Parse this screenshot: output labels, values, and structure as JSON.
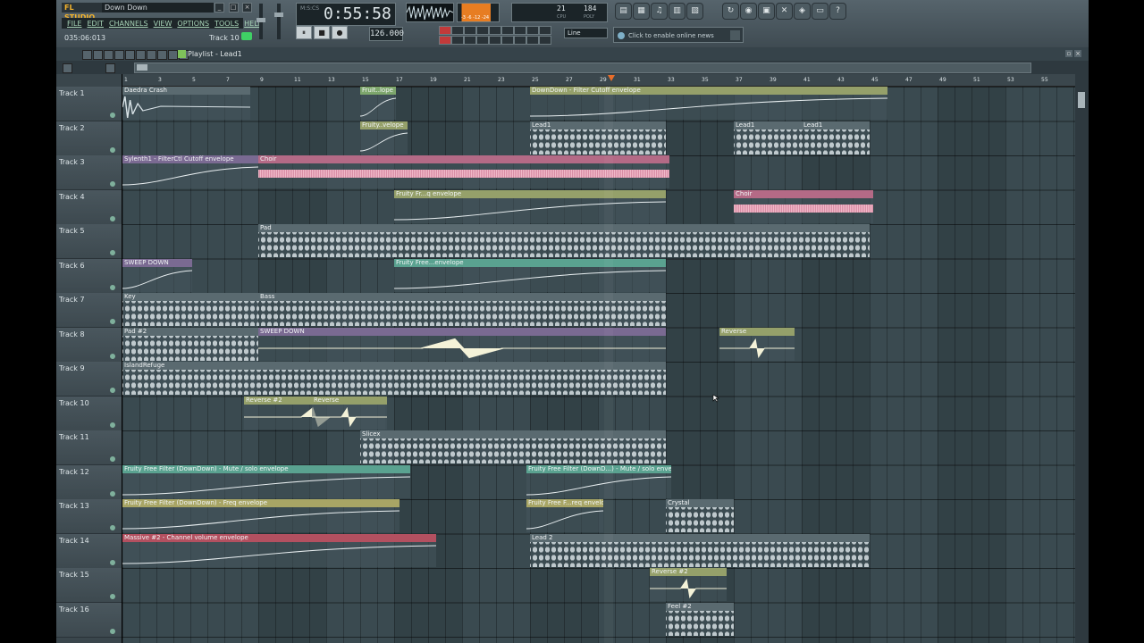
{
  "app": {
    "logo": "FL STUDIO",
    "song_name": "Down Down",
    "menu": [
      "FILE",
      "EDIT",
      "CHANNELS",
      "VIEW",
      "OPTIONS",
      "TOOLS",
      "HELP"
    ],
    "position": "035:06:013",
    "hint_track": "Track 10",
    "time_label": "M:S:CS",
    "time": "0:55:58",
    "tempo": "126.000",
    "cpu": {
      "poly_value": "21",
      "poly_label": "CPU",
      "mem_value": "184",
      "mem_label": "POLY"
    },
    "snap": "Line",
    "news": "Click to enable online news",
    "transport": {
      "pause": "⏸",
      "stop": "■",
      "record": "●"
    },
    "window_buttons": [
      "_",
      "□",
      "×"
    ]
  },
  "playlist": {
    "title": "Playlist - Lead1",
    "ruler_ticks": [
      "1",
      "3",
      "5",
      "7",
      "9",
      "11",
      "13",
      "15",
      "17",
      "19",
      "21",
      "23",
      "25",
      "27",
      "29",
      "31",
      "33",
      "35",
      "37",
      "39",
      "41",
      "43",
      "45",
      "47",
      "49",
      "51",
      "53",
      "55"
    ],
    "tracks": [
      "Track 1",
      "Track 2",
      "Track 3",
      "Track 4",
      "Track 5",
      "Track 6",
      "Track 7",
      "Track 8",
      "Track 9",
      "Track 10",
      "Track 11",
      "Track 12",
      "Track 13",
      "Track 14",
      "Track 15",
      "Track 16"
    ]
  },
  "clips": [
    {
      "row": 0,
      "label": "Daedra Crash",
      "color": "grey",
      "kind": "crash"
    },
    {
      "row": 0,
      "label": "Fruit..lope",
      "color": "green",
      "kind": "env"
    },
    {
      "row": 0,
      "label": "DownDown - Filter Cutoff envelope",
      "color": "olive",
      "kind": "env"
    },
    {
      "row": 1,
      "label": "Fruity..velope",
      "color": "olive",
      "kind": "env"
    },
    {
      "row": 1,
      "label": "Lead1",
      "color": "grey",
      "kind": "notes"
    },
    {
      "row": 1,
      "label": "Lead1",
      "color": "grey",
      "kind": "notes"
    },
    {
      "row": 1,
      "label": "Lead1",
      "color": "grey",
      "kind": "notes"
    },
    {
      "row": 2,
      "label": "Sylenth1 - FilterCtl Cutoff envelope",
      "color": "purple",
      "kind": "env"
    },
    {
      "row": 2,
      "label": "Choir",
      "color": "pink",
      "kind": "wave"
    },
    {
      "row": 3,
      "label": "Fruity Fr...q envelope",
      "color": "olive",
      "kind": "env"
    },
    {
      "row": 3,
      "label": "Choir",
      "color": "pink",
      "kind": "wave"
    },
    {
      "row": 4,
      "label": "Pad",
      "color": "grey",
      "kind": "notes"
    },
    {
      "row": 5,
      "label": "SWEEP DOWN",
      "color": "purple",
      "kind": "env"
    },
    {
      "row": 5,
      "label": "Fruity Free...envelope",
      "color": "teal",
      "kind": "env"
    },
    {
      "row": 6,
      "label": "Key",
      "color": "grey",
      "kind": "notes"
    },
    {
      "row": 6,
      "label": "Bass",
      "color": "grey",
      "kind": "notes"
    },
    {
      "row": 7,
      "label": "Pad #2",
      "color": "grey",
      "kind": "notes"
    },
    {
      "row": 7,
      "label": "SWEEP DOWN",
      "color": "purple",
      "kind": "wave"
    },
    {
      "row": 7,
      "label": "Reverse",
      "color": "olive",
      "kind": "wave"
    },
    {
      "row": 8,
      "label": "IslandRefuge",
      "color": "grey",
      "kind": "notes"
    },
    {
      "row": 9,
      "label": "Reverse #2",
      "color": "olive",
      "kind": "wave"
    },
    {
      "row": 9,
      "label": "Reverse",
      "color": "olive",
      "kind": "wave"
    },
    {
      "row": 10,
      "label": "Slicex",
      "color": "grey",
      "kind": "notes"
    },
    {
      "row": 11,
      "label": "Fruity Free Filter (DownDown) - Mute / solo envelope",
      "color": "teal",
      "kind": "env"
    },
    {
      "row": 11,
      "label": "Fruity Free Filter (DownD...) - Mute / solo envelope",
      "color": "teal",
      "kind": "env"
    },
    {
      "row": 12,
      "label": "Fruity Free Filter (DownDown) - Freq envelope",
      "color": "yel",
      "kind": "env"
    },
    {
      "row": 12,
      "label": "Fruity Free F...req envelope",
      "color": "yel",
      "kind": "env"
    },
    {
      "row": 12,
      "label": "Crystal",
      "color": "grey",
      "kind": "notes"
    },
    {
      "row": 13,
      "label": "Massive #2 - Channel volume envelope",
      "color": "red",
      "kind": "env"
    },
    {
      "row": 13,
      "label": "Lead 2",
      "color": "grey",
      "kind": "notes"
    },
    {
      "row": 14,
      "label": "Reverse #2",
      "color": "olive",
      "kind": "wave"
    },
    {
      "row": 15,
      "label": "Feel #2",
      "color": "grey",
      "kind": "notes"
    }
  ],
  "colors": {
    "accent": "#f7b52b",
    "playhead": "#e86d2a",
    "pink_wave": "#f0b8c8",
    "led": "#3fd065"
  }
}
